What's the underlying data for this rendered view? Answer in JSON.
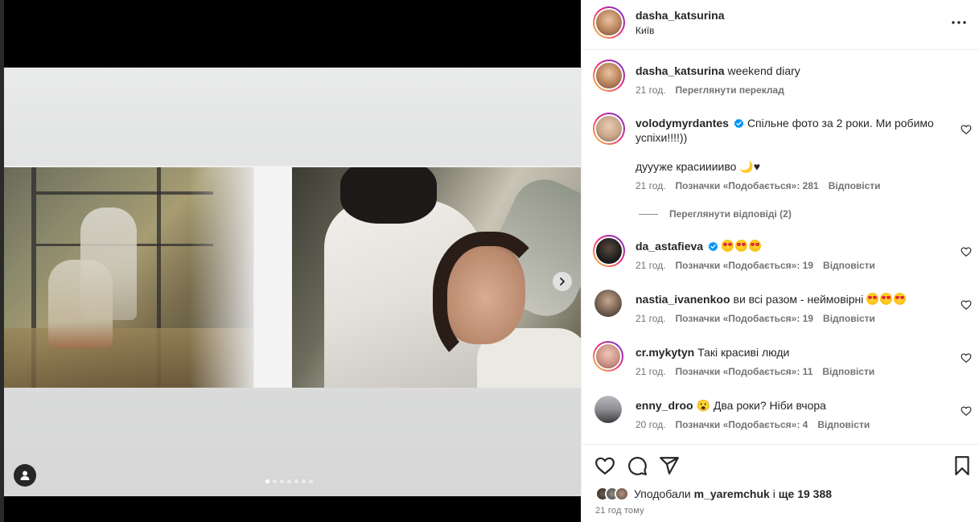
{
  "post": {
    "author": "dasha_katsurina",
    "location": "Київ",
    "caption_user": "dasha_katsurina",
    "caption_text": "weekend diary",
    "caption_time": "21 год.",
    "caption_translate": "Переглянути переклад",
    "carousel_dots": 7
  },
  "comments": [
    {
      "user": "volodymyrdantes",
      "verified": true,
      "text": "Спільне фото за 2 роки. Ми робимо успіхи!!!!))",
      "avatar_color": "#c9a58a"
    },
    {
      "user": "",
      "text": "дуууже красииииво 🌙♥",
      "time": "21 год.",
      "likes": "Позначки «Подобається»: 281",
      "reply": "Відповісти",
      "view_replies": "Переглянути відповіді (2)"
    },
    {
      "user": "da_astafieva",
      "verified": true,
      "emojis": 3,
      "time": "21 год.",
      "likes": "Позначки «Подобається»: 19",
      "reply": "Відповісти",
      "avatar_color": "#1a1a1a"
    },
    {
      "user": "nastia_ivanenkoo",
      "text": "ви всі разом - неймовірні",
      "emojis": 3,
      "time": "21 год.",
      "likes": "Позначки «Подобається»: 19",
      "reply": "Відповісти",
      "avatar_color": "#6f5a4c"
    },
    {
      "user": "cr.mykytyn",
      "text": "Такі красиві люди",
      "time": "21 год.",
      "likes": "Позначки «Подобається»: 11",
      "reply": "Відповісти",
      "avatar_color": "#c98f82"
    },
    {
      "user": "enny_droo",
      "text": "😮 Два роки? Ніби вчора",
      "time": "20 год.",
      "likes": "Позначки «Подобається»: 4",
      "reply": "Відповісти",
      "avatar_color": "#8e8e93"
    }
  ],
  "footer": {
    "liked_by_prefix": "Уподобали",
    "liked_by_user": "m_yaremchuk",
    "liked_by_suffix": "і",
    "liked_by_count": "ще 19 388",
    "time_ago": "21 год тому"
  },
  "icons": {
    "more": "more-horizontal-icon",
    "like": "heart-icon",
    "comment": "comment-icon",
    "share": "paper-plane-icon",
    "save": "bookmark-icon",
    "next": "chevron-right-icon",
    "tag": "user-tag-icon",
    "verified": "verified-badge-icon"
  },
  "colors": {
    "verified": "#0095f6",
    "text_primary": "#262626",
    "text_secondary": "#737373"
  }
}
